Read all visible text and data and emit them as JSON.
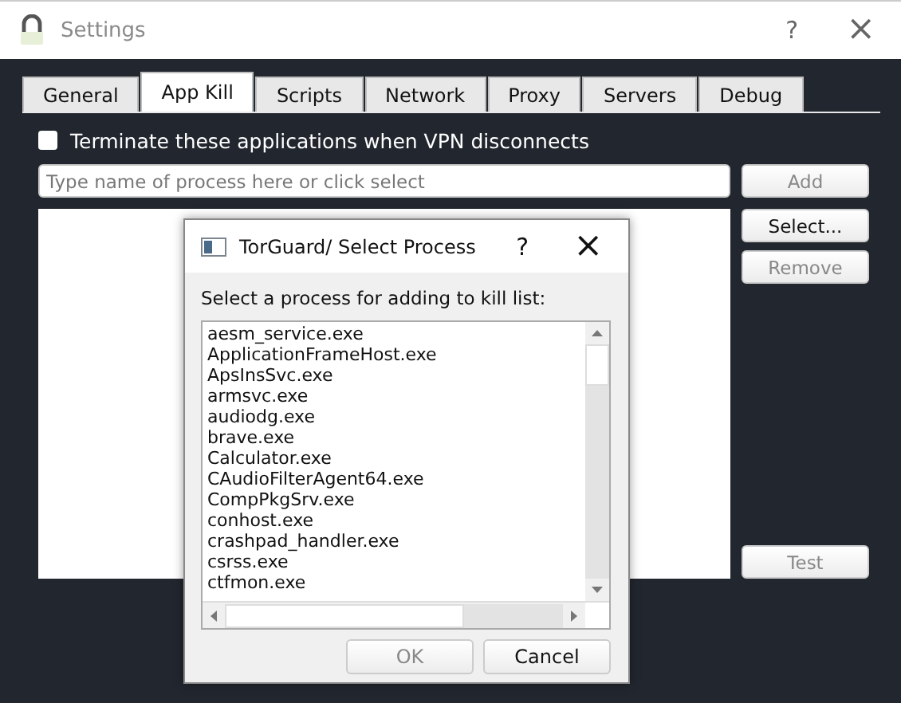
{
  "window": {
    "title": "Settings",
    "help": "?",
    "close": "×"
  },
  "tabs": [
    {
      "label": "General",
      "selected": false
    },
    {
      "label": "App Kill",
      "selected": true
    },
    {
      "label": "Scripts",
      "selected": false
    },
    {
      "label": "Network",
      "selected": false
    },
    {
      "label": "Proxy",
      "selected": false
    },
    {
      "label": "Servers",
      "selected": false
    },
    {
      "label": "Debug",
      "selected": false
    }
  ],
  "terminate_checkbox": {
    "label": "Terminate these applications when VPN disconnects",
    "checked": false
  },
  "process_field": {
    "placeholder": "Type name of process here or click select"
  },
  "buttons": [
    {
      "label": "Add",
      "disabled": true
    },
    {
      "label": "Select...",
      "disabled": false
    },
    {
      "label": "Remove",
      "disabled": true
    }
  ],
  "test_button": {
    "label": "Test",
    "disabled": true
  },
  "dialog": {
    "title": "TorGuard/ Select Process",
    "help": "?",
    "close": "×",
    "prompt": "Select a process for adding to kill list:",
    "processes": [
      "aesm_service.exe",
      "ApplicationFrameHost.exe",
      "ApsInsSvc.exe",
      "armsvc.exe",
      "audiodg.exe",
      "brave.exe",
      "Calculator.exe",
      "CAudioFilterAgent64.exe",
      "CompPkgSrv.exe",
      "conhost.exe",
      "crashpad_handler.exe",
      "csrss.exe",
      "ctfmon.exe"
    ],
    "buttons": [
      {
        "label": "OK",
        "disabled": true
      },
      {
        "label": "Cancel",
        "disabled": false
      }
    ]
  }
}
